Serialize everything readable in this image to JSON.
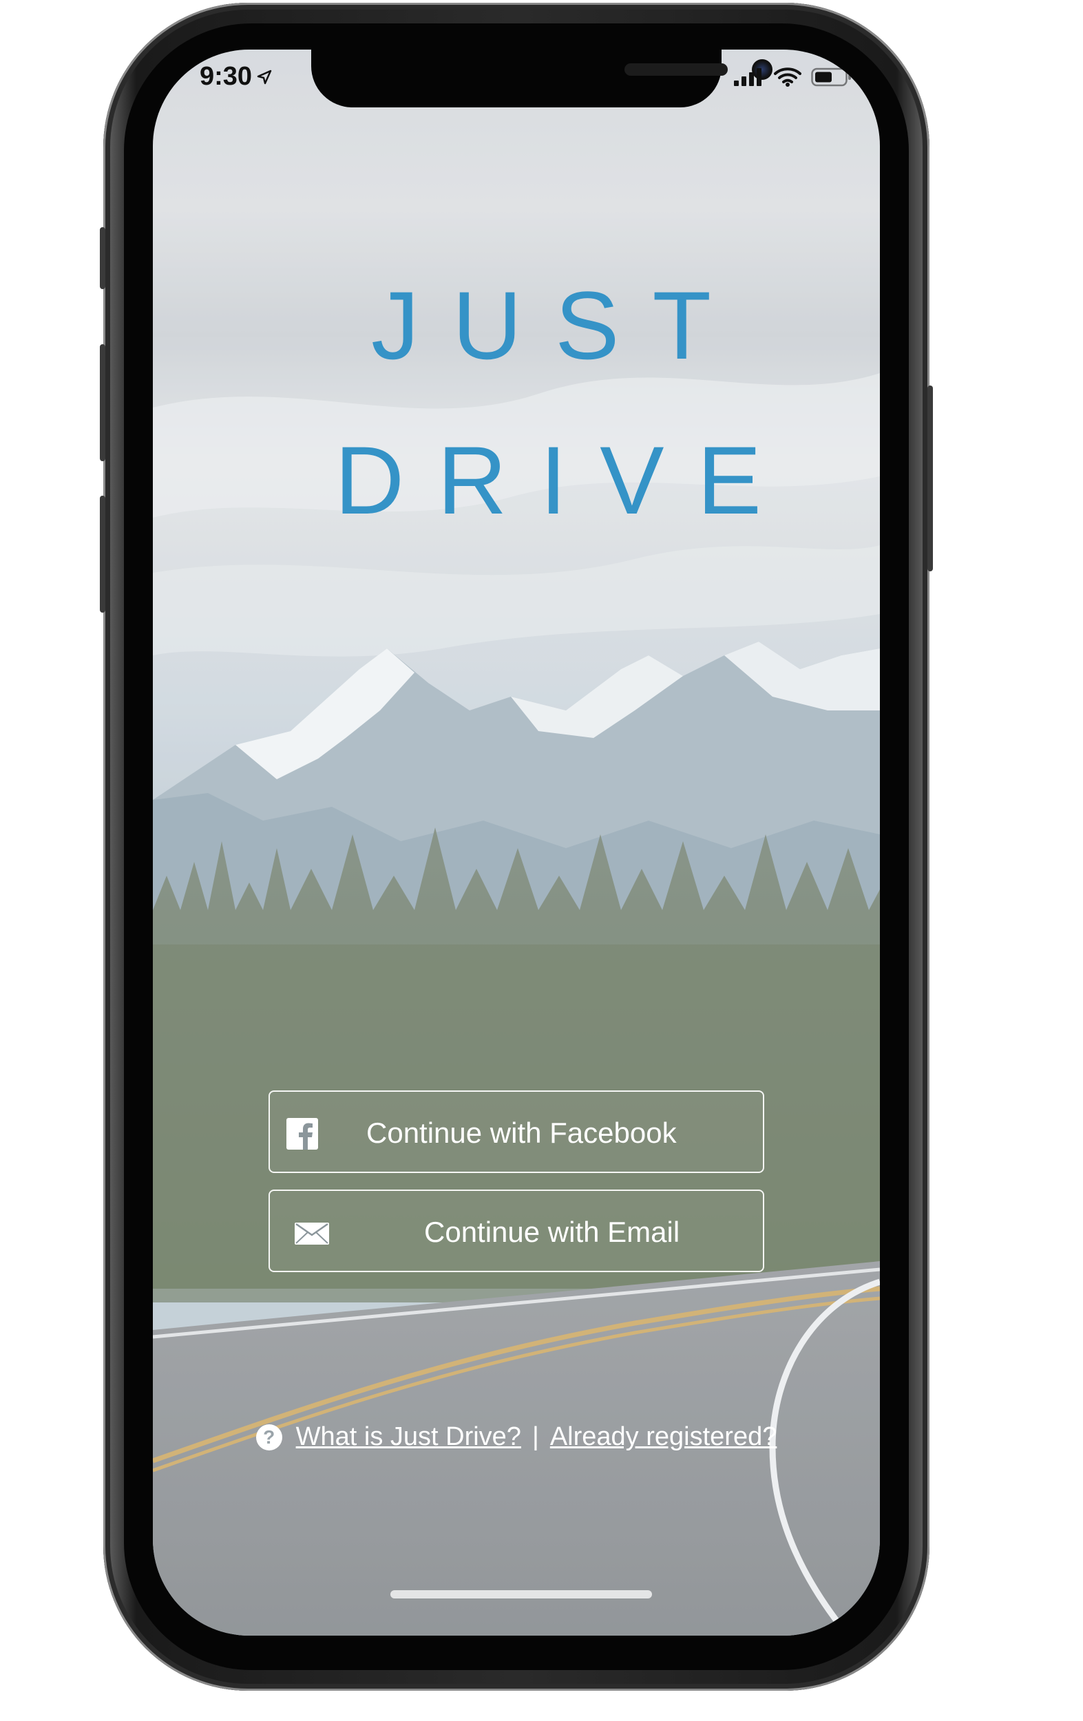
{
  "status_bar": {
    "time": "9:30",
    "icons": [
      "location-arrow-icon",
      "cellular-signal-icon",
      "wifi-icon",
      "battery-icon"
    ]
  },
  "brand": {
    "title_line_1": "JUST",
    "title_line_2": "DRIVE",
    "accent_color": "#3593c7"
  },
  "auth": {
    "facebook": {
      "label": "Continue with Facebook",
      "icon": "facebook-icon"
    },
    "email": {
      "label": "Continue with Email",
      "icon": "envelope-icon"
    }
  },
  "footer": {
    "help_icon_glyph": "?",
    "what_is_link": "What is Just Drive?",
    "separator": "|",
    "registered_link": "Already registered?"
  }
}
